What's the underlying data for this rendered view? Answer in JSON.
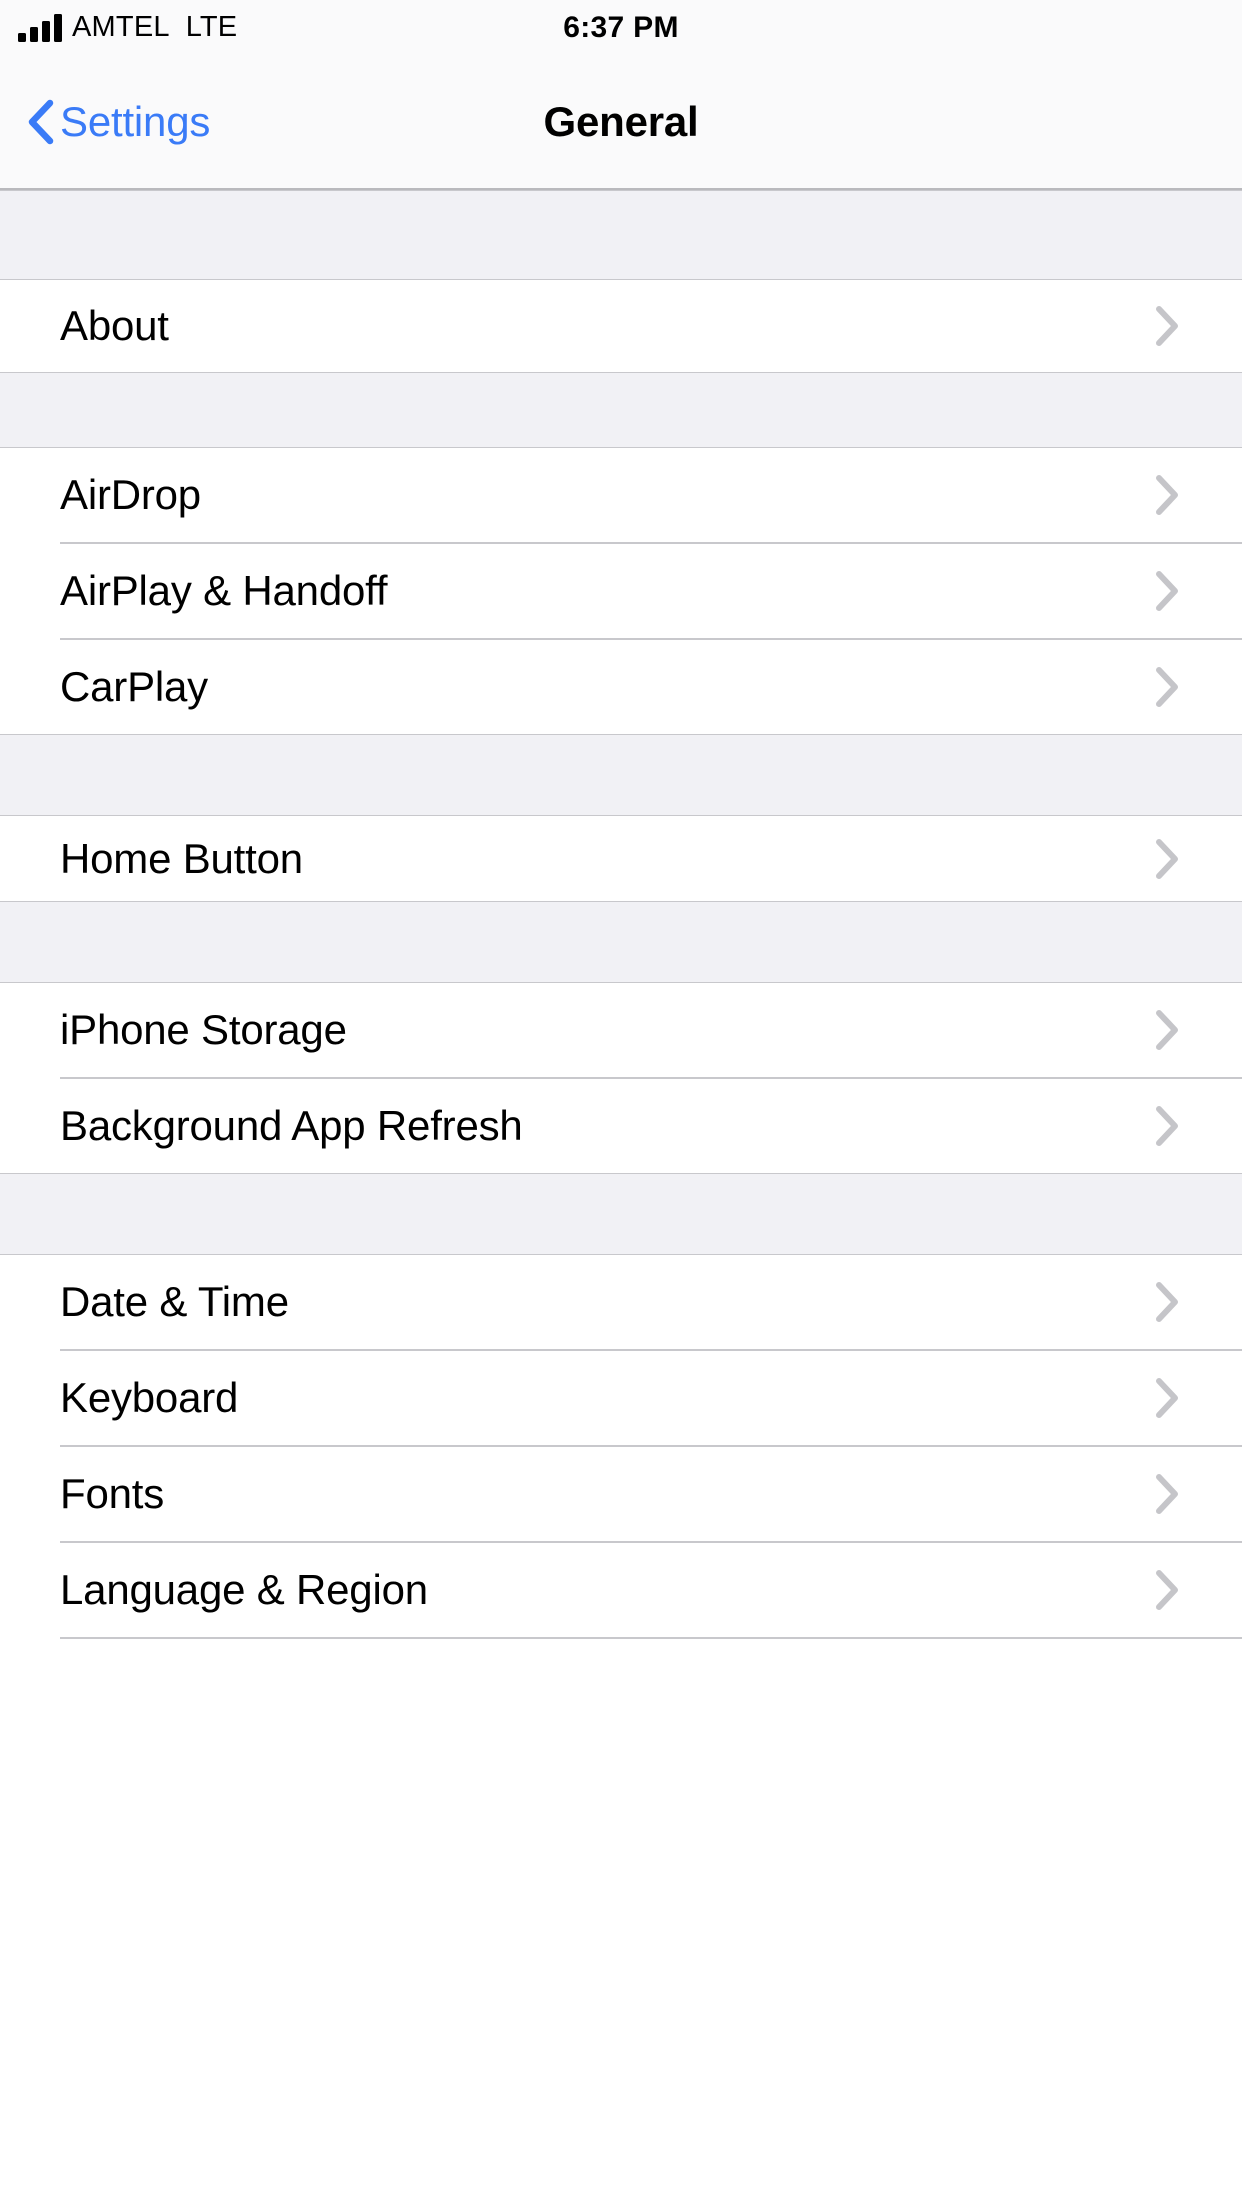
{
  "status_bar": {
    "carrier": "AMTEL",
    "radio_tech": "LTE",
    "signal_bars": 4,
    "time": "6:37 PM"
  },
  "nav_bar": {
    "back_label": "Settings",
    "title": "General",
    "back_icon": "chevron-left-icon",
    "tint_color": "#3a7bf7"
  },
  "colors": {
    "group_background": "#f1f1f5",
    "row_background": "#ffffff",
    "separator": "#c8c8cc",
    "chevron": "#c5c5c9",
    "label": "#000000"
  },
  "sections": [
    {
      "id": "about-section",
      "rows": [
        {
          "id": "about",
          "label": "About",
          "accessory": "chevron-right-icon"
        }
      ]
    },
    {
      "id": "connectivity-section",
      "rows": [
        {
          "id": "airdrop",
          "label": "AirDrop",
          "accessory": "chevron-right-icon"
        },
        {
          "id": "airplay-handoff",
          "label": "AirPlay & Handoff",
          "accessory": "chevron-right-icon"
        },
        {
          "id": "carplay",
          "label": "CarPlay",
          "accessory": "chevron-right-icon"
        }
      ]
    },
    {
      "id": "home-button-section",
      "rows": [
        {
          "id": "home-button",
          "label": "Home Button",
          "accessory": "chevron-right-icon"
        }
      ]
    },
    {
      "id": "storage-section",
      "rows": [
        {
          "id": "iphone-storage",
          "label": "iPhone Storage",
          "accessory": "chevron-right-icon"
        },
        {
          "id": "background-app-refresh",
          "label": "Background App Refresh",
          "accessory": "chevron-right-icon"
        }
      ]
    },
    {
      "id": "localization-section",
      "rows": [
        {
          "id": "date-time",
          "label": "Date & Time",
          "accessory": "chevron-right-icon"
        },
        {
          "id": "keyboard",
          "label": "Keyboard",
          "accessory": "chevron-right-icon"
        },
        {
          "id": "fonts",
          "label": "Fonts",
          "accessory": "chevron-right-icon"
        },
        {
          "id": "language-region",
          "label": "Language & Region",
          "accessory": "chevron-right-icon"
        }
      ]
    }
  ]
}
